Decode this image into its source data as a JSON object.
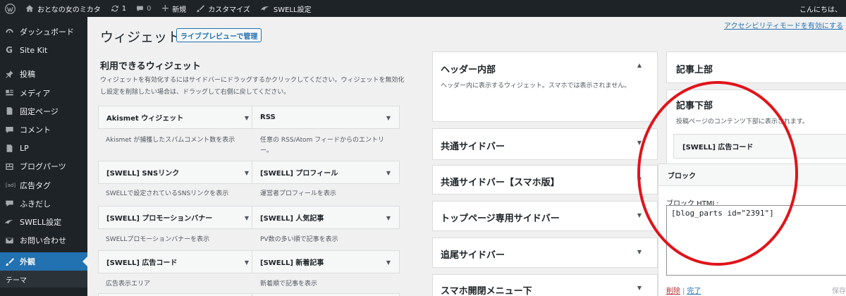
{
  "adminbar": {
    "site_name": "おとなの女のミカタ",
    "updates_count": "1",
    "comments_count": "0",
    "new_label": "新規",
    "customize_label": "カスタマイズ",
    "swell_settings_label": "SWELL設定",
    "greeting": "こんにちは、"
  },
  "sidebar": {
    "items": [
      {
        "label": "ダッシュボード",
        "icon": "dashboard-icon"
      },
      {
        "label": "Site Kit",
        "icon": "sitekit-icon"
      },
      {
        "label": "投稿",
        "icon": "pin-icon"
      },
      {
        "label": "メディア",
        "icon": "media-icon"
      },
      {
        "label": "固定ページ",
        "icon": "page-icon"
      },
      {
        "label": "コメント",
        "icon": "comment-icon"
      },
      {
        "label": "LP",
        "icon": "lp-icon"
      },
      {
        "label": "ブログパーツ",
        "icon": "blogparts-icon"
      },
      {
        "label": "広告タグ",
        "icon": "ad-icon",
        "icon_text": "[ad]"
      },
      {
        "label": "ふきだし",
        "icon": "bubble-icon"
      },
      {
        "label": "SWELL設定",
        "icon": "swell-icon"
      },
      {
        "label": "お問い合わせ",
        "icon": "mail-icon"
      },
      {
        "label": "外観",
        "icon": "brush-icon",
        "active": true
      }
    ],
    "submenu_first": "テーマ"
  },
  "main": {
    "title": "ウィジェット",
    "live_preview_button": "ライブプレビューで管理",
    "a11y_link": "アクセシビリティモードを有効にする",
    "available_title": "利用できるウィジェット",
    "available_desc": "ウィジェットを有効化するにはサイドバーにドラッグするかクリックしてください。ウィジェットを無効化し設定を削除したい場合は、ドラッグして右側に戻してください。"
  },
  "widgets": [
    {
      "name": "Akismet ウィジェット",
      "desc": "Akismet が捕獲したスパムコメント数を表示"
    },
    {
      "name": "RSS",
      "desc": "任意の RSS/Atom フィードからのエントリー。"
    },
    {
      "name": "[SWELL] SNSリンク",
      "desc": "SWELLで設定されているSNSリンクを表示"
    },
    {
      "name": "[SWELL] プロフィール",
      "desc": "運営者プロフィールを表示"
    },
    {
      "name": "[SWELL] プロモーションバナー",
      "desc": "SWELLプロモーションバナーを表示"
    },
    {
      "name": "[SWELL] 人気記事",
      "desc": "PV数の多い順で記事を表示"
    },
    {
      "name": "[SWELL] 広告コード",
      "desc": "広告表示エリア"
    },
    {
      "name": "[SWELL] 新着記事",
      "desc": "新着順で記事を表示"
    }
  ],
  "areas": {
    "header_inner": {
      "title": "ヘッダー内部",
      "desc": "ヘッダー内に表示するウィジェット。スマホでは表示されません。"
    },
    "common_sidebar": {
      "title": "共通サイドバー"
    },
    "common_sidebar_sp": {
      "title": "共通サイドバー【スマホ版】"
    },
    "top_sidebar": {
      "title": "トップページ専用サイドバー"
    },
    "follow_sidebar": {
      "title": "追尾サイドバー"
    },
    "sp_menu_bottom": {
      "title": "スマホ開閉メニュー下"
    },
    "article_top": {
      "title": "記事上部"
    },
    "article_bottom": {
      "title": "記事下部",
      "desc": "投稿ページのコンテンツ下部に表示されます。"
    }
  },
  "article_bottom_widget": {
    "name": "[SWELL] 広告コード",
    "block_title": "ブロック",
    "block_html_label": "ブロック HTML:",
    "block_html_value": "[blog_parts id=\"2391\"]",
    "delete_label": "削除",
    "separator": "|",
    "done_label": "完了",
    "save_label": "保存"
  },
  "colors": {
    "admin_dark": "#1d2327",
    "accent": "#2271b1",
    "annotation_red": "#e0141a"
  }
}
